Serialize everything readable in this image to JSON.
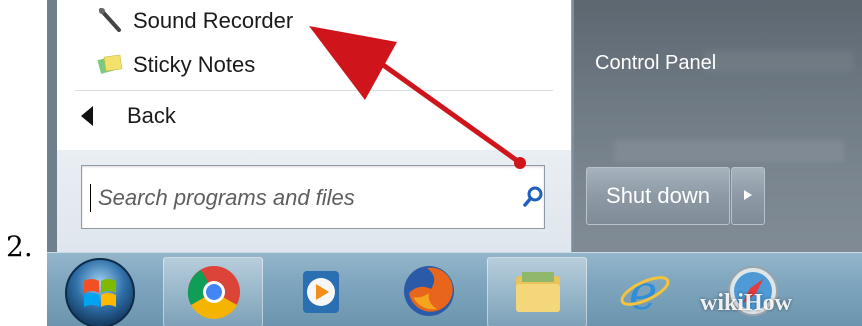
{
  "step": {
    "number": "2."
  },
  "start_menu": {
    "programs": [
      {
        "label": "Sound Recorder",
        "icon": "microphone-icon"
      },
      {
        "label": "Sticky Notes",
        "icon": "sticky-notes-icon"
      }
    ],
    "back_label": "Back",
    "search": {
      "placeholder": "Search programs and files",
      "value": ""
    },
    "right_items": [
      {
        "label": "Control Panel"
      }
    ],
    "shutdown_label": "Shut down"
  },
  "taskbar": {
    "items": [
      {
        "name": "start-orb",
        "icon": "windows-start-icon"
      },
      {
        "name": "chrome",
        "icon": "chrome-icon"
      },
      {
        "name": "media-player",
        "icon": "media-player-icon"
      },
      {
        "name": "firefox",
        "icon": "firefox-icon"
      },
      {
        "name": "explorer",
        "icon": "folder-icon"
      },
      {
        "name": "internet-explorer",
        "icon": "ie-icon"
      },
      {
        "name": "safari",
        "icon": "safari-icon"
      }
    ]
  },
  "watermark": "wikiHow",
  "annotation": {
    "color": "#d0141c",
    "points_to": "Sound Recorder"
  },
  "colors": {
    "accent_blue": "#1f5fbf",
    "taskbar": "#7fa6be"
  }
}
